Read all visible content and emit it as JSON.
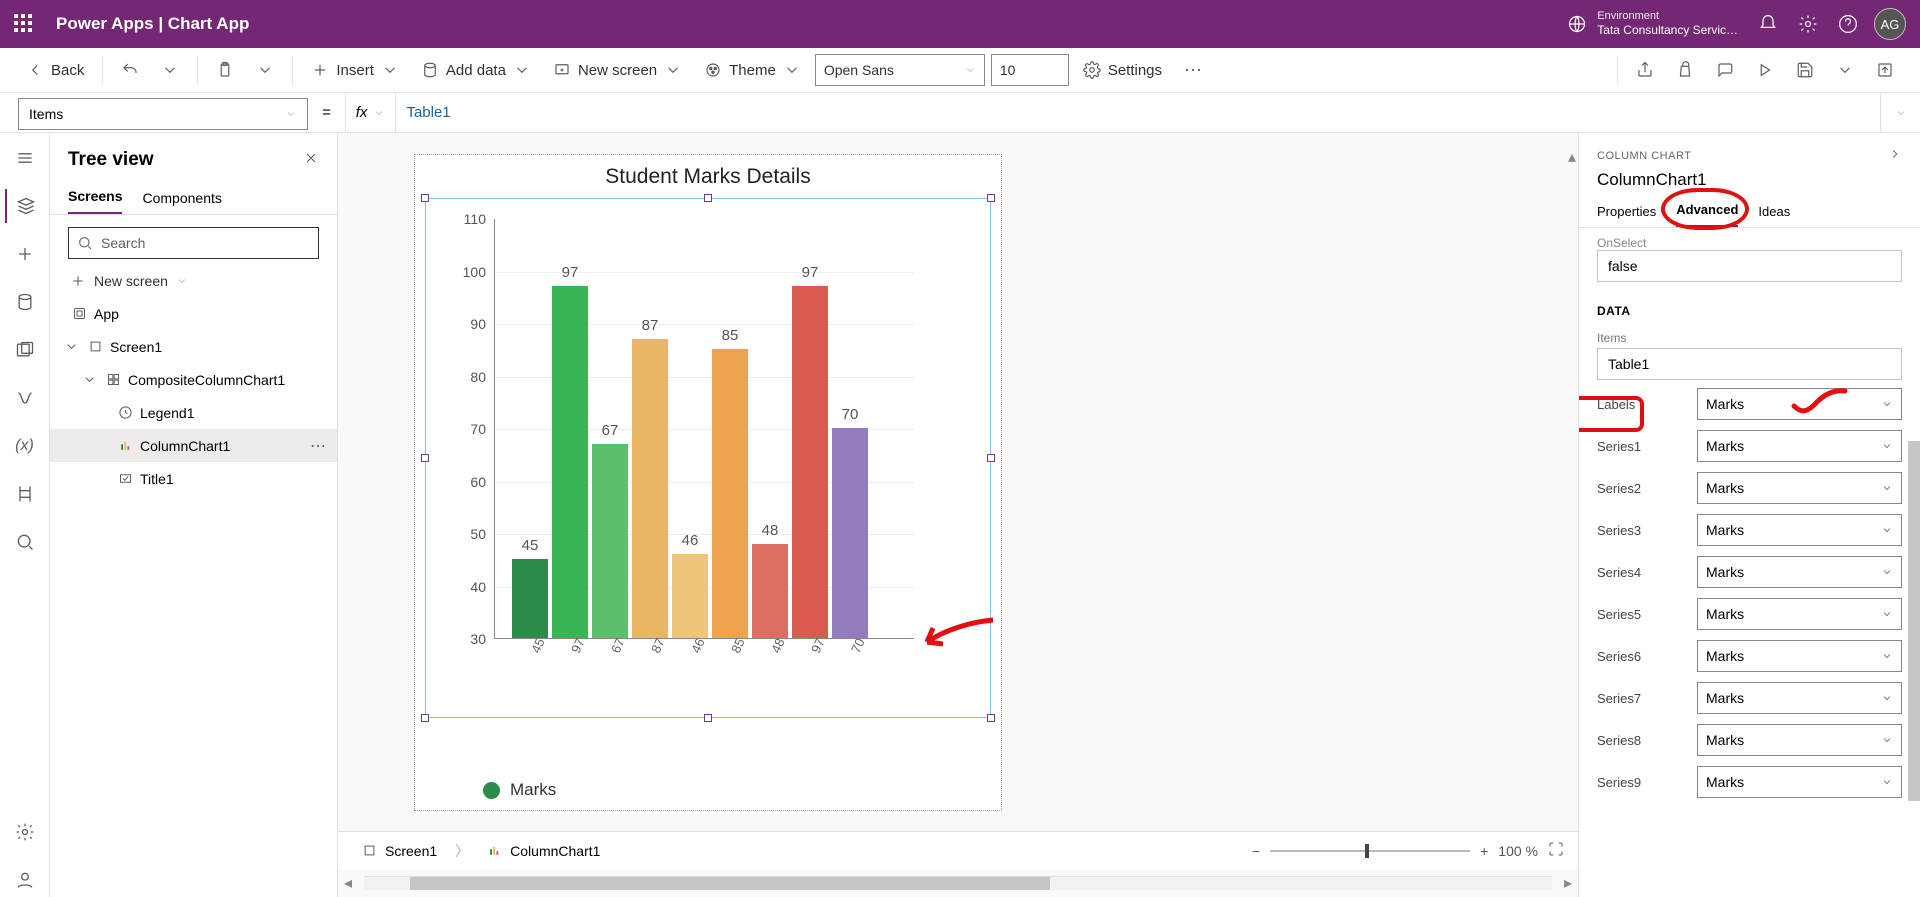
{
  "header": {
    "brand": "Power Apps  |  Chart App",
    "env_label": "Environment",
    "env_value": "Tata Consultancy Servic…",
    "avatar": "AG"
  },
  "commandbar": {
    "back": "Back",
    "insert": "Insert",
    "add_data": "Add data",
    "new_screen": "New screen",
    "theme": "Theme",
    "font_name": "Open Sans",
    "font_size": "10",
    "settings": "Settings"
  },
  "fxbar": {
    "property": "Items",
    "formula": "Table1"
  },
  "treeview": {
    "title": "Tree view",
    "tab_screens": "Screens",
    "tab_components": "Components",
    "search_placeholder": "Search",
    "new_screen": "New screen",
    "items": {
      "app": "App",
      "screen1": "Screen1",
      "composite": "CompositeColumnChart1",
      "legend": "Legend1",
      "columnchart": "ColumnChart1",
      "title": "Title1"
    }
  },
  "chart_data": {
    "type": "bar",
    "title": "Student Marks Details",
    "legend": "Marks",
    "categories": [
      "45",
      "97",
      "67",
      "87",
      "46",
      "85",
      "48",
      "97",
      "70"
    ],
    "values": [
      45,
      97,
      67,
      87,
      46,
      85,
      48,
      97,
      70
    ],
    "colors": [
      "#2a8b4a",
      "#3ab556",
      "#5cbf6c",
      "#e9b763",
      "#eec679",
      "#eda34d",
      "#dd6f62",
      "#d95b4f",
      "#937bbd"
    ],
    "ylim": [
      30,
      110
    ],
    "yticks": [
      30,
      40,
      50,
      60,
      70,
      80,
      90,
      100,
      110
    ]
  },
  "breadcrumbs": {
    "screen": "Screen1",
    "chart": "ColumnChart1",
    "zoom": "100 %"
  },
  "props": {
    "type_label": "COLUMN CHART",
    "name": "ColumnChart1",
    "tab_properties": "Properties",
    "tab_advanced": "Advanced",
    "tab_ideas": "Ideas",
    "onselect_label": "OnSelect",
    "onselect_value": "false",
    "data_header": "DATA",
    "items_label": "Items",
    "items_value": "Table1",
    "fields": [
      {
        "label": "Labels",
        "value": "Marks"
      },
      {
        "label": "Series1",
        "value": "Marks"
      },
      {
        "label": "Series2",
        "value": "Marks"
      },
      {
        "label": "Series3",
        "value": "Marks"
      },
      {
        "label": "Series4",
        "value": "Marks"
      },
      {
        "label": "Series5",
        "value": "Marks"
      },
      {
        "label": "Series6",
        "value": "Marks"
      },
      {
        "label": "Series7",
        "value": "Marks"
      },
      {
        "label": "Series8",
        "value": "Marks"
      },
      {
        "label": "Series9",
        "value": "Marks"
      }
    ]
  }
}
